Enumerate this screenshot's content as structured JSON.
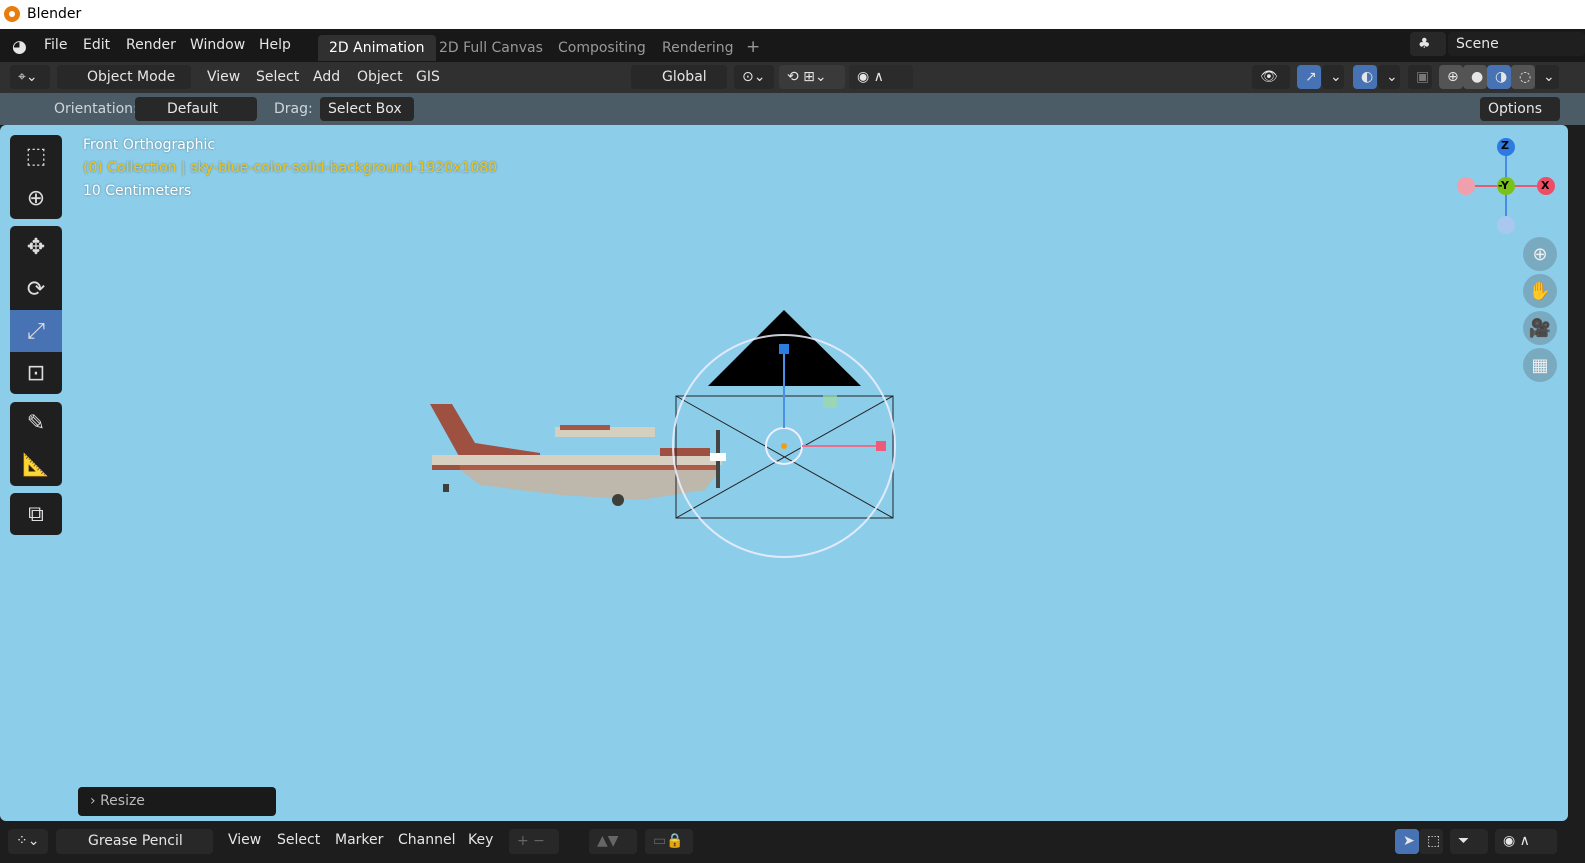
{
  "window": {
    "title": "Blender"
  },
  "menu": {
    "items": [
      "File",
      "Edit",
      "Render",
      "Window",
      "Help"
    ]
  },
  "workspaces": {
    "tabs": [
      "2D Animation",
      "2D Full Canvas",
      "Compositing",
      "Rendering"
    ],
    "add": "+",
    "active": "2D Animation"
  },
  "scene": {
    "name": "Scene"
  },
  "header": {
    "mode": "Object Mode",
    "menus": [
      "View",
      "Select",
      "Add",
      "Object",
      "GIS"
    ],
    "orientation": "Global"
  },
  "tool_settings": {
    "orientation_label": "Orientation:",
    "orientation_value": "Default",
    "drag_label": "Drag:",
    "drag_value": "Select Box",
    "options": "Options"
  },
  "viewport": {
    "view_name": "Front Orthographic",
    "collection": "(0) Collection | sky-blue-color-solid-background-1920x1080",
    "scale": "10 Centimeters",
    "background": "#8ccde9",
    "gizmo": {
      "z": "Z",
      "y": "-Y",
      "x": "X"
    }
  },
  "toolbar": {
    "tools": [
      "select-box",
      "cursor",
      "move",
      "rotate",
      "scale",
      "transform",
      "annotate",
      "measure",
      "add-cube"
    ],
    "active": "scale"
  },
  "last_operator": {
    "label": "Resize"
  },
  "timeline": {
    "editor": "Grease Pencil",
    "menus": [
      "View",
      "Select",
      "Marker",
      "Channel",
      "Key"
    ]
  }
}
